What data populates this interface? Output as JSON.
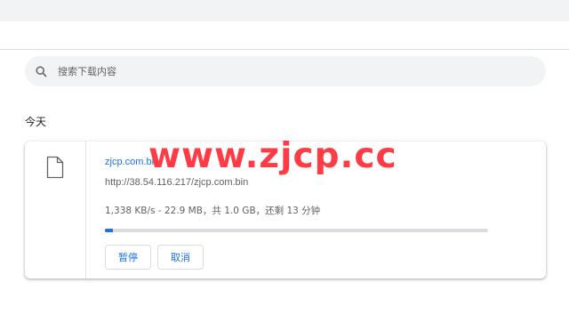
{
  "search": {
    "placeholder": "搜索下载内容",
    "icon": "search-icon"
  },
  "section": {
    "date_label": "今天"
  },
  "download": {
    "file_name": "zjcp.com.bin",
    "url": "http://38.54.116.217/zjcp.com.bin",
    "status": "1,338 KB/s - 22.9 MB，共 1.0 GB，还剩 13 分钟",
    "progress_percent": 2,
    "pause_label": "暂停",
    "cancel_label": "取消",
    "file_icon": "file-icon"
  },
  "watermark": {
    "text": "www.zjcp.cc"
  },
  "colors": {
    "accent": "#1a73e8",
    "watermark": "#ff3b45",
    "search_bg": "#f1f3f4",
    "topbar_bg": "#f1f3f4",
    "progress_track": "#dadce0"
  }
}
